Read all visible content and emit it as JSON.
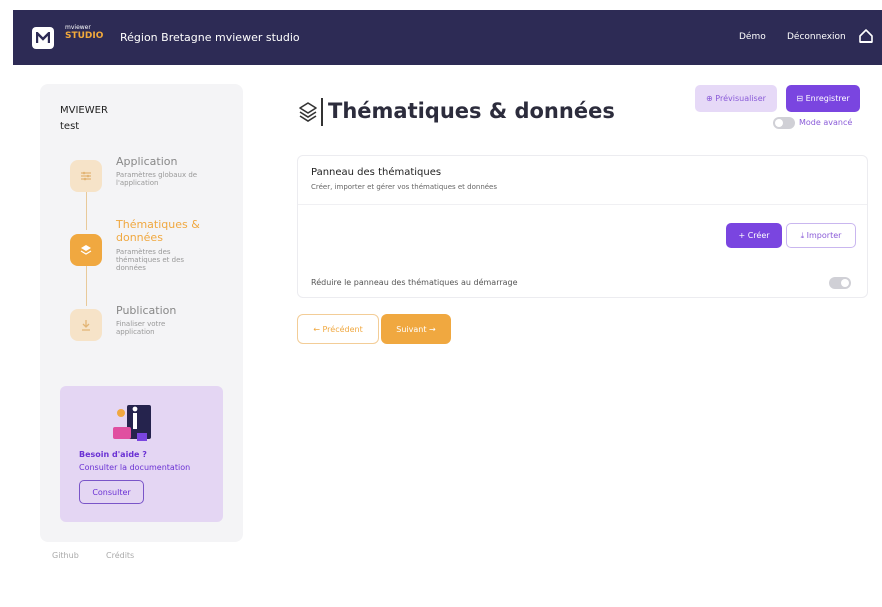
{
  "header": {
    "logo_small": "mviewer",
    "logo_studio": "STUDIO",
    "title": "Région Bretagne mviewer studio",
    "nav_demo": "Démo",
    "nav_logout": "Déconnexion"
  },
  "sidebar": {
    "label": "MVIEWER",
    "project": "test",
    "steps": [
      {
        "title": "Application",
        "desc": "Paramètres globaux de l'application"
      },
      {
        "title": "Thématiques & données",
        "desc": "Paramètres des thématiques et des données"
      },
      {
        "title": "Publication",
        "desc": "Finaliser votre application"
      }
    ],
    "help": {
      "title": "Besoin d'aide ?",
      "subtitle": "Consulter la documentation",
      "button": "Consulter"
    },
    "footer": {
      "github": "Github",
      "credits": "Crédits"
    }
  },
  "main": {
    "title": "Thématiques & données",
    "preview_button": "⊕ Prévisualiser",
    "save_button": "⊟ Enregistrer",
    "advanced_mode": "Mode avancé",
    "panel": {
      "title": "Panneau des thématiques",
      "subtitle": "Créer, importer et gérer vos thématiques et données",
      "create_button": "+ Créer",
      "import_button": "⤓ Importer",
      "reduce_label": "Réduire le panneau des thématiques au démarrage"
    },
    "prev_button": "← Précédent",
    "next_button": "Suivant →"
  },
  "colors": {
    "header_bg": "#2d2b55",
    "accent_orange": "#f0a840",
    "accent_purple": "#7a45e0"
  }
}
